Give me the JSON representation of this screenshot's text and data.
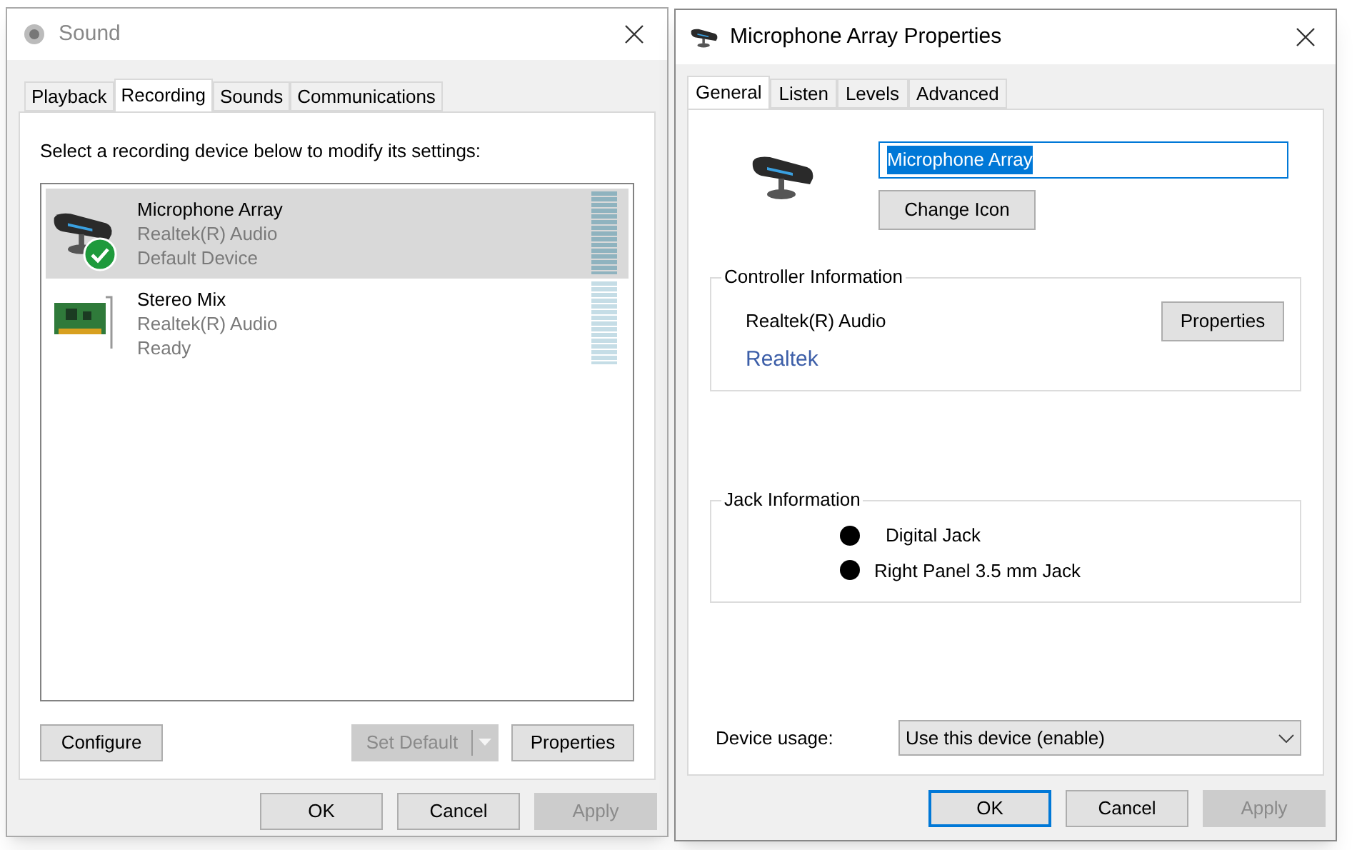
{
  "sound_dialog": {
    "title": "Sound",
    "tabs": [
      {
        "label": "Playback",
        "selected": false
      },
      {
        "label": "Recording",
        "selected": true
      },
      {
        "label": "Sounds",
        "selected": false
      },
      {
        "label": "Communications",
        "selected": false
      }
    ],
    "instruction": "Select a recording device below to modify its settings:",
    "devices": [
      {
        "kind": "microphone",
        "name": "Microphone Array",
        "driver": "Realtek(R) Audio",
        "status": "Default Device",
        "selected": true,
        "default": true
      },
      {
        "kind": "sound_card",
        "name": "Stereo Mix",
        "driver": "Realtek(R) Audio",
        "status": "Ready",
        "selected": false,
        "default": false
      }
    ],
    "configure_button": {
      "label": "Configure",
      "disabled": false
    },
    "set_default_button": {
      "label": "Set Default",
      "disabled": true
    },
    "properties_button": {
      "label": "Properties",
      "disabled": false
    },
    "footer_buttons": [
      {
        "label": "OK",
        "disabled": false,
        "focused": false
      },
      {
        "label": "Cancel",
        "disabled": false,
        "focused": false
      },
      {
        "label": "Apply",
        "disabled": true,
        "focused": false
      }
    ]
  },
  "properties_dialog": {
    "title": "Microphone Array Properties",
    "tabs": [
      {
        "label": "General",
        "selected": true
      },
      {
        "label": "Listen",
        "selected": false
      },
      {
        "label": "Levels",
        "selected": false
      },
      {
        "label": "Advanced",
        "selected": false
      }
    ],
    "name_field": {
      "value": "Microphone Array",
      "text_selected": true
    },
    "change_icon_button": "Change Icon",
    "controller": {
      "heading": "Controller Information",
      "name": "Realtek(R) Audio",
      "link": "Realtek",
      "button": "Properties"
    },
    "jack": {
      "heading": "Jack Information",
      "items": [
        {
          "label": "Digital Jack",
          "color": "#000000"
        },
        {
          "label": "Right Panel 3.5 mm Jack",
          "color": "#000000"
        }
      ]
    },
    "device_usage": {
      "label": "Device usage:",
      "value": "Use this device (enable)"
    },
    "footer_buttons": [
      {
        "label": "OK",
        "disabled": false,
        "focused": true
      },
      {
        "label": "Cancel",
        "disabled": false,
        "focused": false
      },
      {
        "label": "Apply",
        "disabled": true,
        "focused": false
      }
    ]
  }
}
